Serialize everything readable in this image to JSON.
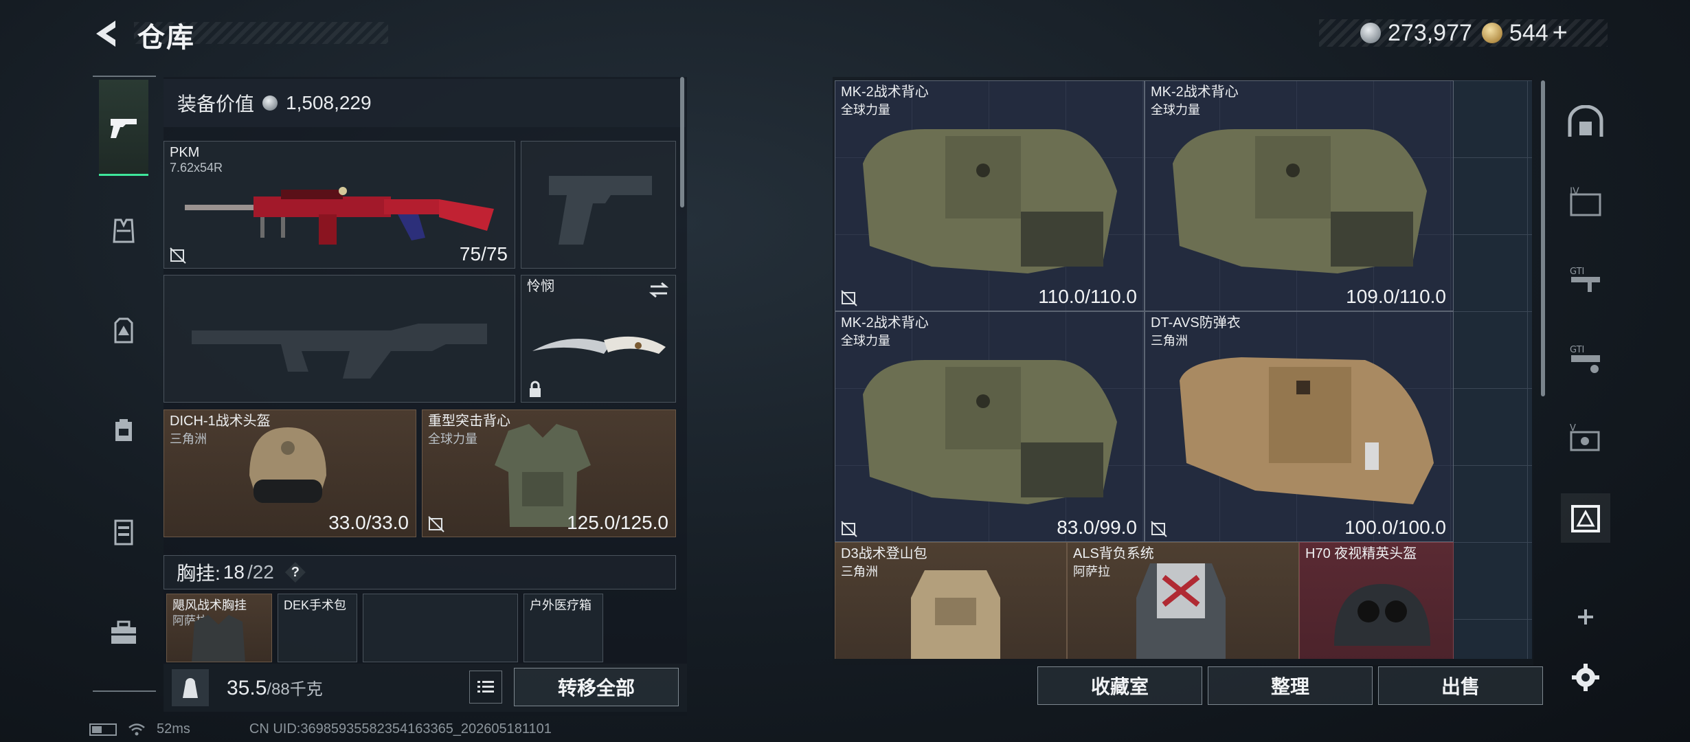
{
  "header": {
    "title": "仓库",
    "currency": [
      {
        "name": "silver-coin",
        "value": "273,977"
      },
      {
        "name": "gold-coin",
        "value": "544"
      }
    ],
    "plus": "+"
  },
  "left_tabs": [
    {
      "icon": "pistol-icon",
      "active": true
    },
    {
      "icon": "vest-icon",
      "active": false
    },
    {
      "icon": "helmet-icon",
      "active": false
    },
    {
      "icon": "backpack-icon",
      "active": false
    },
    {
      "icon": "locker-icon",
      "active": false
    },
    {
      "icon": "briefcase-icon",
      "active": false
    }
  ],
  "loadout": {
    "equip_value_label": "装备价值",
    "equip_value": "1,508,229",
    "primary": {
      "name": "PKM",
      "ammo": "7.62x54R",
      "value": "75/75"
    },
    "melee": {
      "name": "怜悯"
    },
    "helmet": {
      "name": "DICH-1战术头盔",
      "origin": "三角洲",
      "value": "33.0/33.0"
    },
    "armor": {
      "name": "重型突击背心",
      "origin": "全球力量",
      "value": "125.0/125.0"
    },
    "chest_rig": {
      "label": "胸挂:",
      "used": "18",
      "total": "/22",
      "help": "?"
    },
    "rig_items": [
      {
        "name": "飓风战术胸挂",
        "origin": "阿萨拉"
      },
      {
        "name": "DEK手术包",
        "origin": ""
      },
      {
        "name": "",
        "origin": ""
      },
      {
        "name": "户外医疗箱",
        "origin": ""
      }
    ],
    "weight": "35.5",
    "weight_max": "/88千克",
    "transfer_all": "转移全部"
  },
  "stash": {
    "items": [
      {
        "name": "MK-2战术背心",
        "origin": "全球力量",
        "value": "110.0/110.0"
      },
      {
        "name": "MK-2战术背心",
        "origin": "全球力量",
        "value": "109.0/110.0"
      },
      {
        "name": "MK-2战术背心",
        "origin": "全球力量",
        "value": "83.0/99.0"
      },
      {
        "name": "DT-AVS防弹衣",
        "origin": "三角洲",
        "value": "100.0/100.0"
      },
      {
        "name": "D3战术登山包",
        "origin": "三角洲"
      },
      {
        "name": "ALS背负系统",
        "origin": "阿萨拉"
      },
      {
        "name": "H70 夜视精英头盔",
        "origin": ""
      }
    ],
    "buttons": {
      "collection": "收藏室",
      "sort": "整理",
      "sell": "出售"
    }
  },
  "right_tabs": [
    {
      "icon": "safe-house-icon"
    },
    {
      "icon": "stash-tab-4-icon"
    },
    {
      "icon": "stash-tab-gun-icon"
    },
    {
      "icon": "stash-tab-gun2-icon"
    },
    {
      "icon": "stash-tab-5-icon"
    },
    {
      "icon": "stash-tab-armor-icon",
      "active": true
    },
    {
      "icon": "add-tab-icon"
    },
    {
      "icon": "gear-icon"
    }
  ],
  "status": {
    "ping": "52ms",
    "uid": "CN UID:3698593558235416336​5_202605181101"
  },
  "colors": {
    "accent": "#3ee69b",
    "brown_slot": "#4a3b2f",
    "stash_bg": "#1e2a37"
  }
}
